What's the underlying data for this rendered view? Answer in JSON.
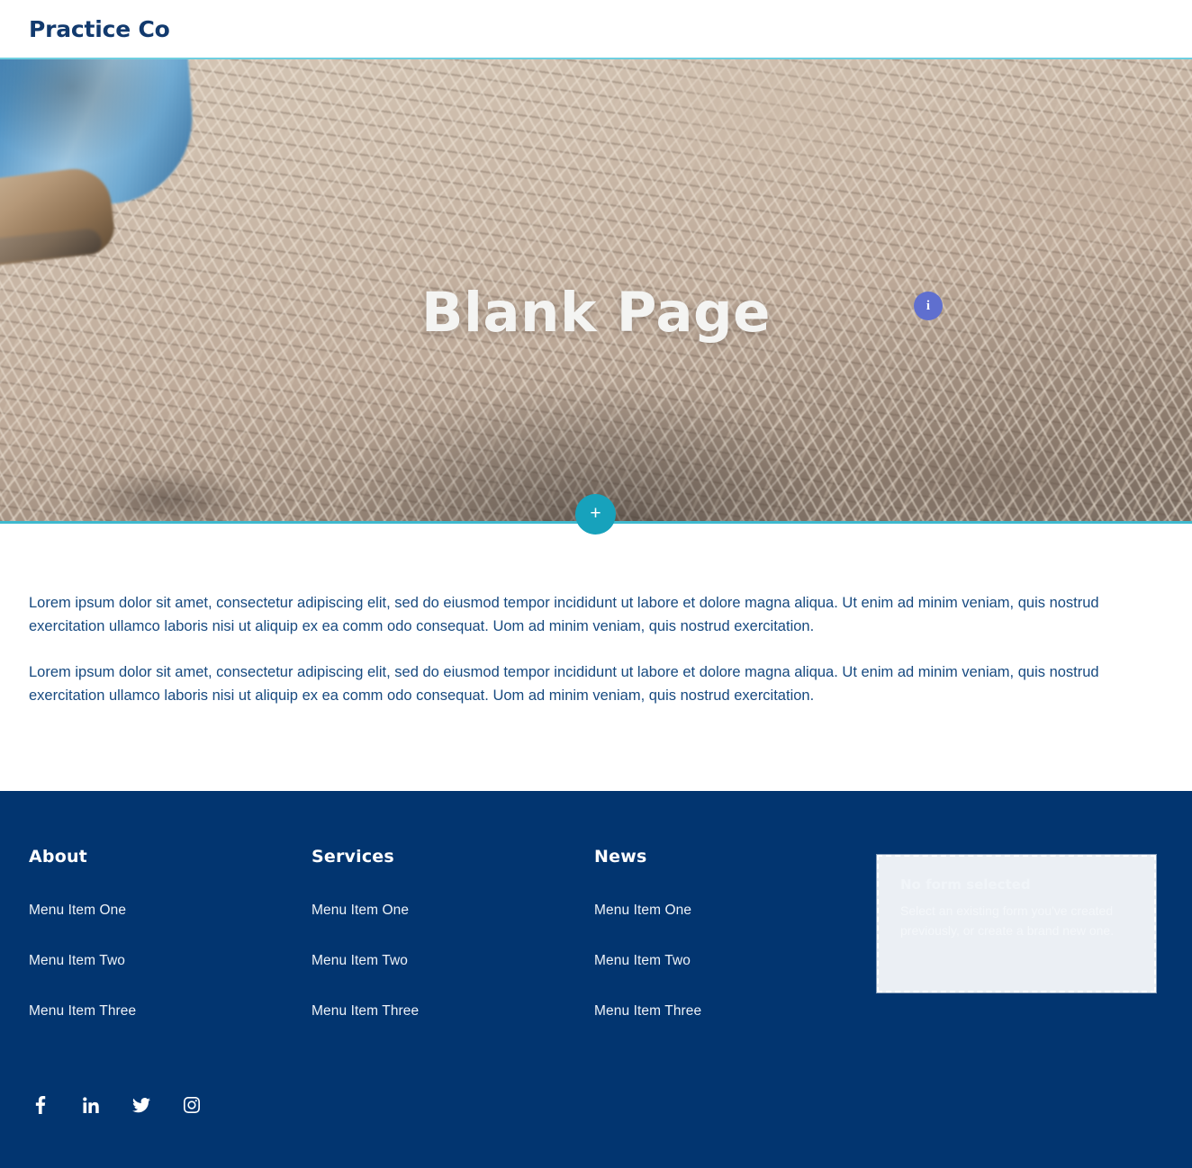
{
  "header": {
    "brand": "Practice Co"
  },
  "hero": {
    "title": "Blank Page",
    "info_pin_label": "i",
    "add_section_label": "+",
    "image_alt": "Close-up photo of a person's jeans and boot standing on dry brushy ground",
    "border_color": "#3fb9cf",
    "accent_color": "#17a2bc",
    "pin_color": "#5f6fcf"
  },
  "content": {
    "paragraphs": [
      "Lorem ipsum dolor sit amet, consectetur adipiscing elit, sed do eiusmod tempor incididunt ut labore et dolore magna aliqua. Ut enim ad minim veniam, quis nostrud exercitation ullamco laboris nisi ut aliquip ex ea comm odo consequat. Uom ad minim veniam, quis nostrud exercitation.",
      "Lorem ipsum dolor sit amet, consectetur adipiscing elit, sed do eiusmod tempor incididunt ut labore et dolore magna aliqua. Ut enim ad minim veniam, quis nostrud exercitation ullamco laboris nisi ut aliquip ex ea comm odo consequat. Uom ad minim veniam, quis nostrud exercitation."
    ],
    "text_color": "#174a80"
  },
  "footer": {
    "background_color": "#023570",
    "columns": [
      {
        "title": "About",
        "links": [
          "Menu Item One",
          "Menu Item Two",
          "Menu Item Three"
        ]
      },
      {
        "title": "Services",
        "links": [
          "Menu Item One",
          "Menu Item Two",
          "Menu Item Three"
        ]
      },
      {
        "title": "News",
        "links": [
          "Menu Item One",
          "Menu Item Two",
          "Menu Item Three"
        ]
      }
    ],
    "form_placeholder": {
      "title": "No form selected",
      "description": "Select an existing form you've created previously, or create a brand new one."
    },
    "social": [
      {
        "name": "facebook-icon",
        "label": "Facebook"
      },
      {
        "name": "linkedin-icon",
        "label": "LinkedIn"
      },
      {
        "name": "twitter-icon",
        "label": "Twitter"
      },
      {
        "name": "instagram-icon",
        "label": "Instagram"
      }
    ]
  }
}
